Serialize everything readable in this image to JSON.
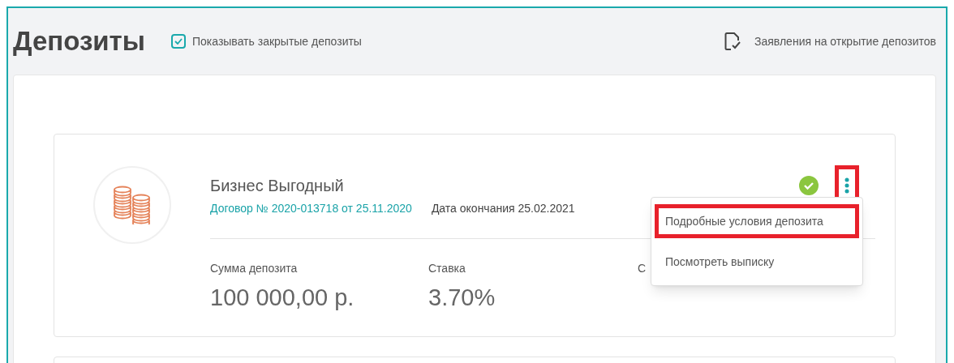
{
  "page": {
    "title": "Депозиты",
    "show_closed": {
      "label": "Показывать закрытые депозиты",
      "checked": true
    },
    "applications_link": "Заявления на открытие депозитов"
  },
  "deposits": [
    {
      "name": "Бизнес Выгодный",
      "contract": "Договор № 2020-013718 от 25.11.2020",
      "end_date": "Дата окончания 25.02.2021",
      "active": true,
      "fields": [
        {
          "label": "Сумма депозита",
          "value": "100 000,00 р."
        },
        {
          "label": "Ставка",
          "value": "3.70%"
        },
        {
          "label": "С"
        }
      ],
      "menu_button": {
        "highlighted": true
      },
      "menu": {
        "open": true,
        "items": [
          {
            "label": "Подробные условия депозита",
            "highlighted": true
          },
          {
            "label": "Посмотреть выписку",
            "highlighted": false
          }
        ]
      }
    }
  ]
}
